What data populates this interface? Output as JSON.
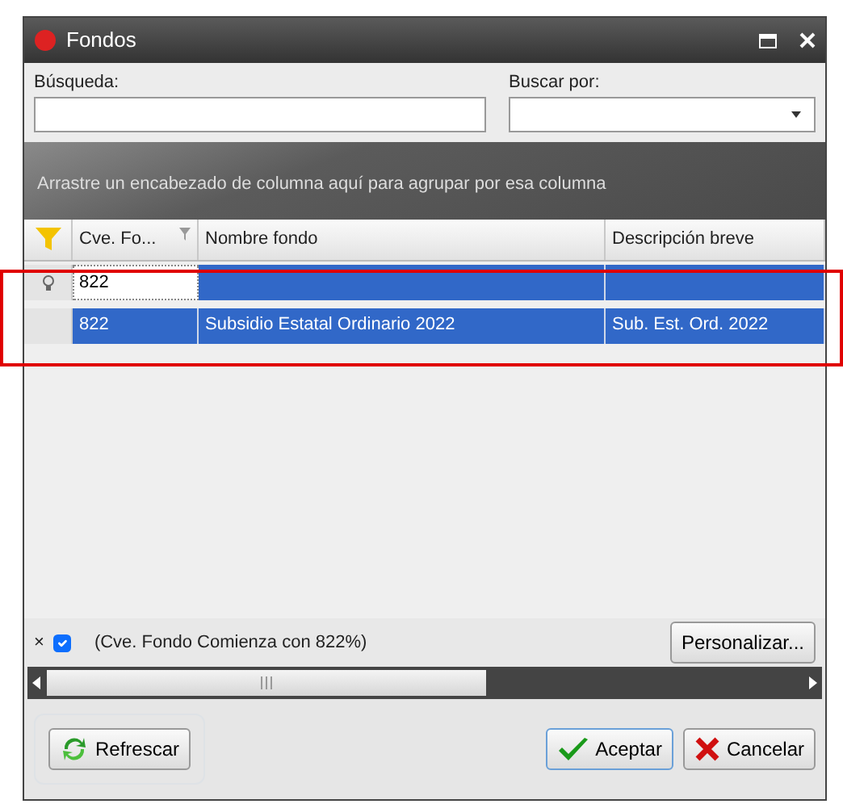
{
  "window": {
    "title": "Fondos"
  },
  "search": {
    "label": "Búsqueda:"
  },
  "search_by": {
    "label": "Buscar por:"
  },
  "group_panel": {
    "hint": "Arrastre un encabezado de columna aquí para agrupar por esa columna"
  },
  "table": {
    "columns": [
      {
        "label": "Cve. Fo...",
        "filtered": true
      },
      {
        "label": "Nombre fondo",
        "filtered": false
      },
      {
        "label": "Descripción breve",
        "filtered": false
      }
    ],
    "filter_row": {
      "value": "822"
    },
    "rows": [
      {
        "cells": [
          "822",
          "Subsidio Estatal Ordinario 2022",
          "Sub. Est. Ord. 2022"
        ],
        "selected": true
      }
    ]
  },
  "filter_bar": {
    "close": "×",
    "checked": true,
    "text": "(Cve. Fondo Comienza con 822%)",
    "customize_button": "Personalizar..."
  },
  "buttons": {
    "refresh": "Refrescar",
    "accept": "Aceptar",
    "cancel": "Cancelar"
  }
}
